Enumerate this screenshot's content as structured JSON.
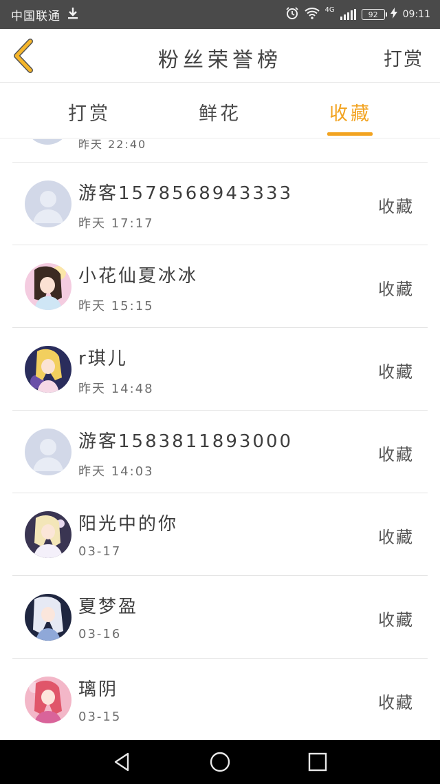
{
  "status_bar": {
    "carrier": "中国联通",
    "time": "09:11",
    "battery": "92",
    "network": "4G",
    "icons": [
      "download-icon",
      "alarm-icon",
      "wifi-icon",
      "signal-icon",
      "battery-icon",
      "charging-icon"
    ]
  },
  "header": {
    "title": "粉丝荣誉榜",
    "right_action": "打赏",
    "back_icon": "chevron-left-icon"
  },
  "tabs": [
    {
      "label": "打赏",
      "active": false
    },
    {
      "label": "鲜花",
      "active": false
    },
    {
      "label": "收藏",
      "active": true
    }
  ],
  "colors": {
    "accent": "#f2a320",
    "back_icon": "#f5b52a",
    "status_bar": "#4a4a4a"
  },
  "partial_row": {
    "time": "昨天 22:40"
  },
  "list": [
    {
      "name": "游客1578568943333",
      "time": "昨天 17:17",
      "action": "收藏",
      "avatar": "default-avatar"
    },
    {
      "name": "小花仙夏冰冰",
      "time": "昨天 15:15",
      "action": "收藏",
      "avatar": "anime-girl-avatar"
    },
    {
      "name": "r琪儿",
      "time": "昨天 14:48",
      "action": "收藏",
      "avatar": "anime-girl-avatar"
    },
    {
      "name": "游客1583811893000",
      "time": "昨天 14:03",
      "action": "收藏",
      "avatar": "default-avatar"
    },
    {
      "name": "阳光中的你",
      "time": "03-17",
      "action": "收藏",
      "avatar": "anime-girl-avatar"
    },
    {
      "name": "夏梦盈",
      "time": "03-16",
      "action": "收藏",
      "avatar": "anime-girl-avatar"
    },
    {
      "name": "璃阴",
      "time": "03-15",
      "action": "收藏",
      "avatar": "anime-girl-avatar"
    }
  ],
  "nav_bar": {
    "icons": [
      "back-triangle-icon",
      "home-circle-icon",
      "recents-square-icon"
    ]
  }
}
